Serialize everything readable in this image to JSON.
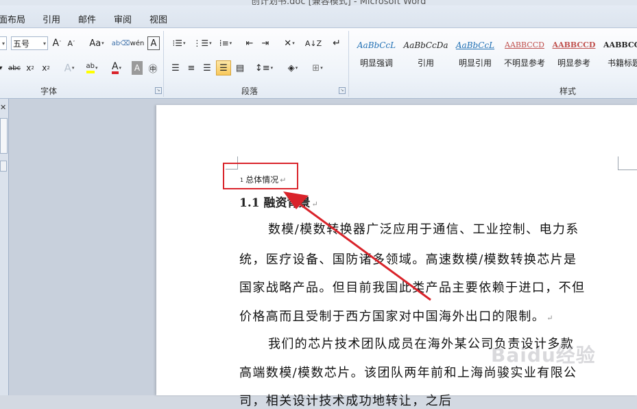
{
  "window": {
    "title": "创计划书.doc [兼容模式] - Microsoft Word"
  },
  "tabs": [
    {
      "label": "面布局"
    },
    {
      "label": "引用"
    },
    {
      "label": "邮件"
    },
    {
      "label": "审阅"
    },
    {
      "label": "视图"
    }
  ],
  "ribbon": {
    "font_size": "五号",
    "highlight_label": "ab",
    "font_color_label": "A",
    "groups": {
      "font": "字体",
      "paragraph": "段落",
      "styles": "样式"
    },
    "styles": [
      {
        "sample": "AaBbCcL",
        "name": "明显强调",
        "color": "#1f6fb4"
      },
      {
        "sample": "AaBbCcDa",
        "name": "引用",
        "color": "#222222"
      },
      {
        "sample": "AaBbCcL",
        "name": "明显引用",
        "color": "#1f6fb4"
      },
      {
        "sample": "AABBCCD",
        "name": "不明显参考",
        "color": "#c0504d"
      },
      {
        "sample": "AABBCCD",
        "name": "明显参考",
        "color": "#c0504d"
      },
      {
        "sample": "AABBCC",
        "name": "书籍标题",
        "color": "#222222"
      }
    ]
  },
  "document": {
    "heading1_number": "1",
    "heading1": "总体情况",
    "heading2": "1.1 融资背景",
    "para_lines": [
      "数模/模数转换器广泛应用于通信、工业控制、电力系",
      "统，医疗设备、国防诸多领域。高速数模/模数转换芯片是",
      "国家战略产品。但目前我国此类产品主要依赖于进口，不但",
      "价格高而且受制于西方国家对中国海外出口的限制。",
      "我们的芯片技术团队成员在海外某公司负责设计多款",
      "高端数模/模数芯片。该团队两年前和上海尚骏实业有限公",
      "司，相关设计技术成功地转让，之后"
    ]
  },
  "watermark": "Baidu经验",
  "colors": {
    "annotation": "#d9232a",
    "accent": "#1f6fb4"
  }
}
